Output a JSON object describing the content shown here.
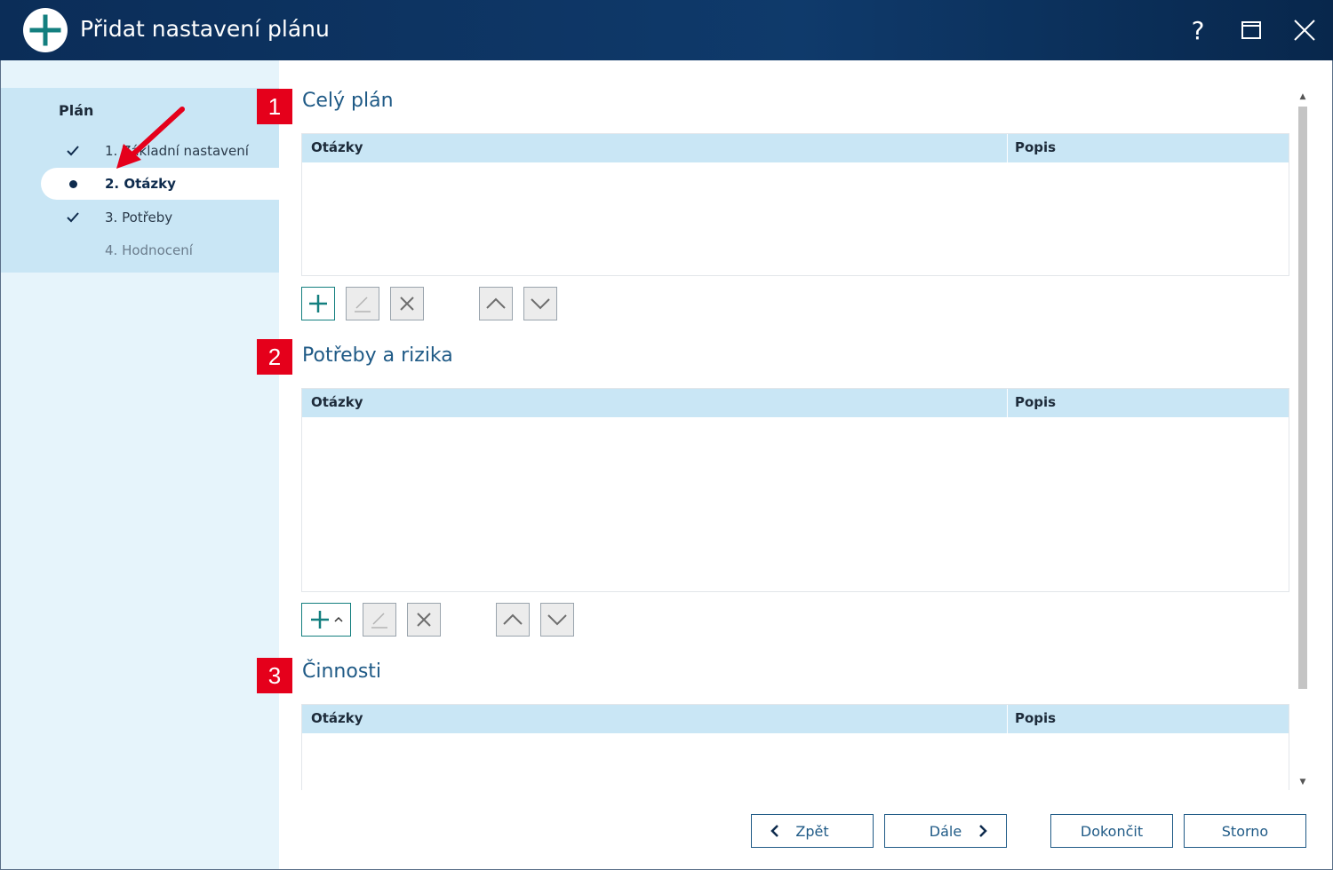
{
  "window": {
    "title": "Přidat nastavení plánu",
    "help_label": "?"
  },
  "nav": {
    "heading": "Plán",
    "items": [
      {
        "label": "1. Základní nastavení",
        "state": "done"
      },
      {
        "label": "2. Otázky",
        "state": "active"
      },
      {
        "label": "3. Potřeby",
        "state": "done"
      },
      {
        "label": "4. Hodnocení",
        "state": "disabled"
      }
    ]
  },
  "callouts": [
    "1",
    "2",
    "3"
  ],
  "sections": [
    {
      "title": "Celý plán",
      "columns": [
        "Otázky",
        "Popis"
      ],
      "rows": []
    },
    {
      "title": "Potřeby a rizika",
      "columns": [
        "Otázky",
        "Popis"
      ],
      "rows": []
    },
    {
      "title": "Činnosti",
      "columns": [
        "Otázky",
        "Popis"
      ],
      "rows": []
    }
  ],
  "footer": {
    "back_label": "Zpět",
    "next_label": "Dále",
    "finish_label": "Dokončit",
    "cancel_label": "Storno"
  },
  "colors": {
    "titlebar": "#0f3a6b",
    "accent": "#1f5a86",
    "add_icon": "#137f7f",
    "callout": "#e5001b",
    "annotation_arrow": "#e5001b"
  },
  "icons": {
    "app": "plus-circle-icon",
    "help": "help-icon",
    "maximize": "maximize-icon",
    "close": "close-icon",
    "add": "plus-icon",
    "edit": "pencil-icon",
    "delete": "x-icon",
    "move_up": "chevron-up-icon",
    "move_down": "chevron-down-icon"
  }
}
